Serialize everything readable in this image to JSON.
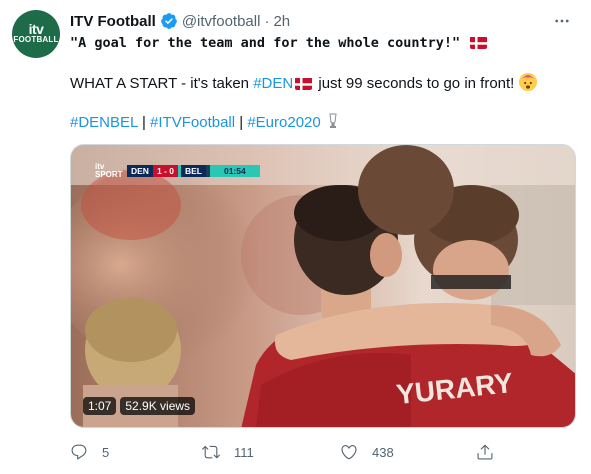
{
  "account": {
    "avatar_line1": "itv",
    "avatar_line2": "FOOTBALL",
    "name": "ITV Football",
    "handle": "@itvfootball",
    "separator": "·",
    "time": "2h"
  },
  "tweet": {
    "quote": "\"A goal for the team and for the whole country!\"",
    "line2_before": "WHAT A START - it's taken ",
    "hashtag_den": "#DEN",
    "line2_after": " just 99 seconds to go in front!",
    "hashtags": [
      "#DENBEL",
      "#ITVFootball",
      "#Euro2020"
    ],
    "hashtag_separator": " | "
  },
  "video": {
    "brand_line1": "itv",
    "brand_line2": "SPORT",
    "team_home": "DEN",
    "score": "1 - 0",
    "team_away": "BEL",
    "clock": "01:54",
    "shirt_text": "YURARY",
    "duration": "1:07",
    "views": "52.9K views"
  },
  "actions": {
    "replies": "5",
    "retweets": "111",
    "likes": "438"
  },
  "colors": {
    "link": "#1b95e0",
    "avatar_bg": "#1d6b49",
    "verified": "#1d9bf0",
    "muted": "#536471"
  }
}
